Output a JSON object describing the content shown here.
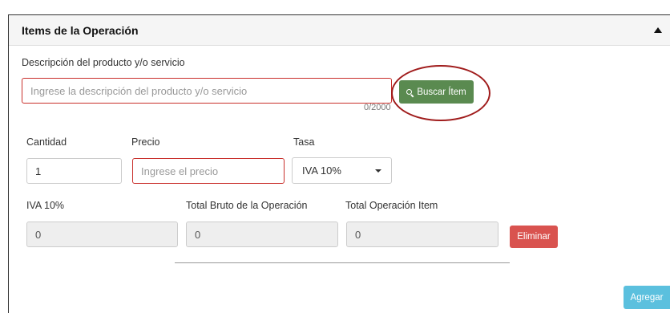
{
  "panel": {
    "title": "Items de la Operación"
  },
  "description": {
    "label": "Descripción del producto y/o servicio",
    "placeholder": "Ingrese la descripción del producto y/o servicio",
    "value": "",
    "counter": "0/2000",
    "search_button": "Buscar Ítem"
  },
  "quantity": {
    "label": "Cantidad",
    "value": "1"
  },
  "price": {
    "label": "Precio",
    "placeholder": "Ingrese el precio",
    "value": ""
  },
  "rate": {
    "label": "Tasa",
    "selected": "IVA 10%"
  },
  "iva": {
    "label": "IVA 10%",
    "value": "0"
  },
  "gross_total": {
    "label": "Total Bruto de la Operación",
    "value": "0"
  },
  "item_total": {
    "label": "Total Operación Item",
    "value": "0"
  },
  "actions": {
    "delete_label": "Eliminar",
    "add_label": "Agregar"
  },
  "colors": {
    "search_button": "#5a8a50",
    "delete_button": "#d9534f",
    "add_button": "#5bc0de",
    "error_border": "#c9302c",
    "highlight": "#a01c1c"
  },
  "icons": {
    "collapse": "chevron-up-icon",
    "search": "search-icon",
    "select": "caret-down-icon"
  }
}
